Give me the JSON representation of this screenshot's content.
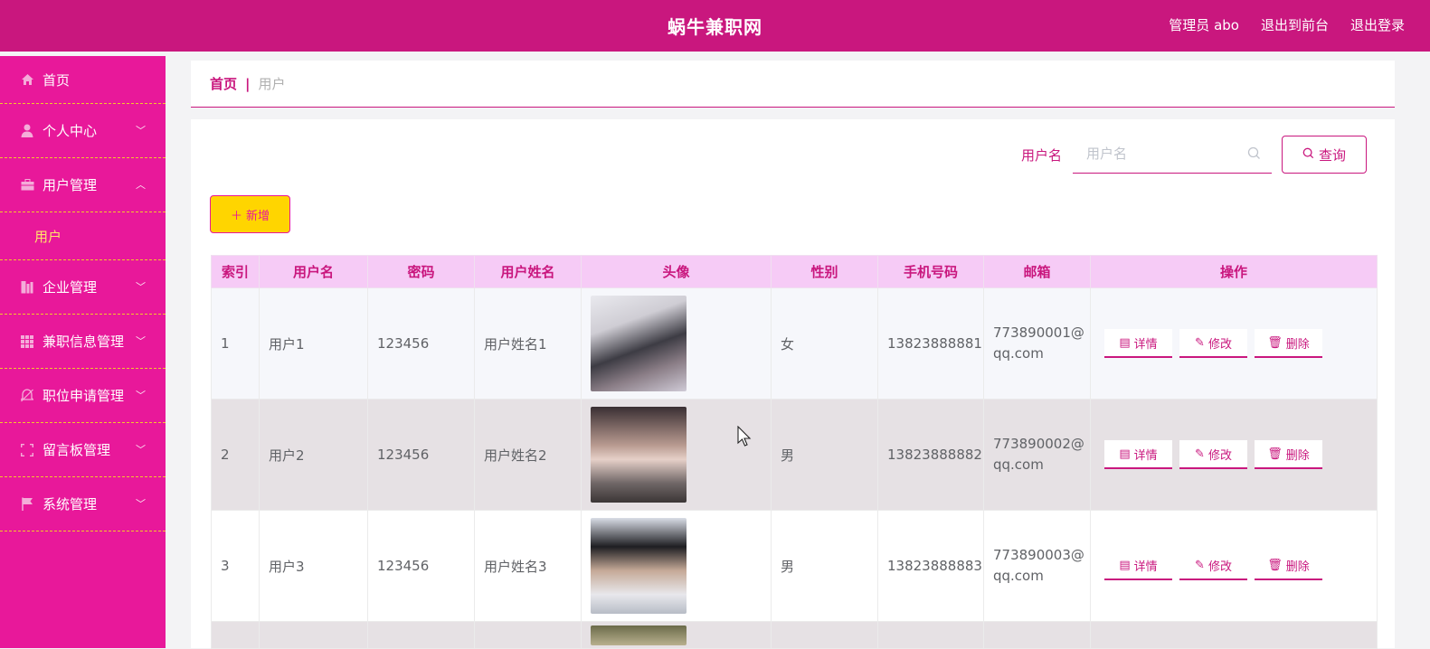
{
  "header": {
    "title": "蜗牛兼职网",
    "admin_label": "管理员 abo",
    "exit_front": "退出到前台",
    "logout": "退出登录"
  },
  "sidebar": {
    "items": [
      {
        "label": "首页",
        "icon": "home-icon"
      },
      {
        "label": "个人中心",
        "icon": "user-icon"
      },
      {
        "label": "用户管理",
        "icon": "briefcase-icon",
        "expanded": true,
        "children": [
          {
            "label": "用户"
          }
        ]
      },
      {
        "label": "企业管理",
        "icon": "building-icon"
      },
      {
        "label": "兼职信息管理",
        "icon": "grid-icon"
      },
      {
        "label": "职位申请管理",
        "icon": "bell-icon"
      },
      {
        "label": "留言板管理",
        "icon": "frame-icon"
      },
      {
        "label": "系统管理",
        "icon": "flag-icon"
      }
    ]
  },
  "breadcrumb": {
    "home": "首页",
    "separator": "|",
    "current": "用户"
  },
  "search": {
    "label": "用户名",
    "placeholder": "用户名",
    "button": "查询"
  },
  "add_button": "新增",
  "table": {
    "columns": [
      "索引",
      "用户名",
      "密码",
      "用户姓名",
      "头像",
      "性别",
      "手机号码",
      "邮箱",
      "操作"
    ],
    "rows": [
      {
        "index": "1",
        "username": "用户1",
        "password": "123456",
        "name": "用户姓名1",
        "gender": "女",
        "phone": "13823888881",
        "email_a": "773890001@",
        "email_b": "qq.com"
      },
      {
        "index": "2",
        "username": "用户2",
        "password": "123456",
        "name": "用户姓名2",
        "gender": "男",
        "phone": "13823888882",
        "email_a": "773890002@",
        "email_b": "qq.com"
      },
      {
        "index": "3",
        "username": "用户3",
        "password": "123456",
        "name": "用户姓名3",
        "gender": "男",
        "phone": "13823888883",
        "email_a": "773890003@",
        "email_b": "qq.com"
      }
    ],
    "actions": {
      "detail": "详情",
      "edit": "修改",
      "delete": "删除"
    }
  },
  "colors": {
    "header": "#c9177e",
    "sidebar": "#e8189a",
    "accent_yellow": "#ffd500",
    "table_head": "#f6cbf6"
  }
}
